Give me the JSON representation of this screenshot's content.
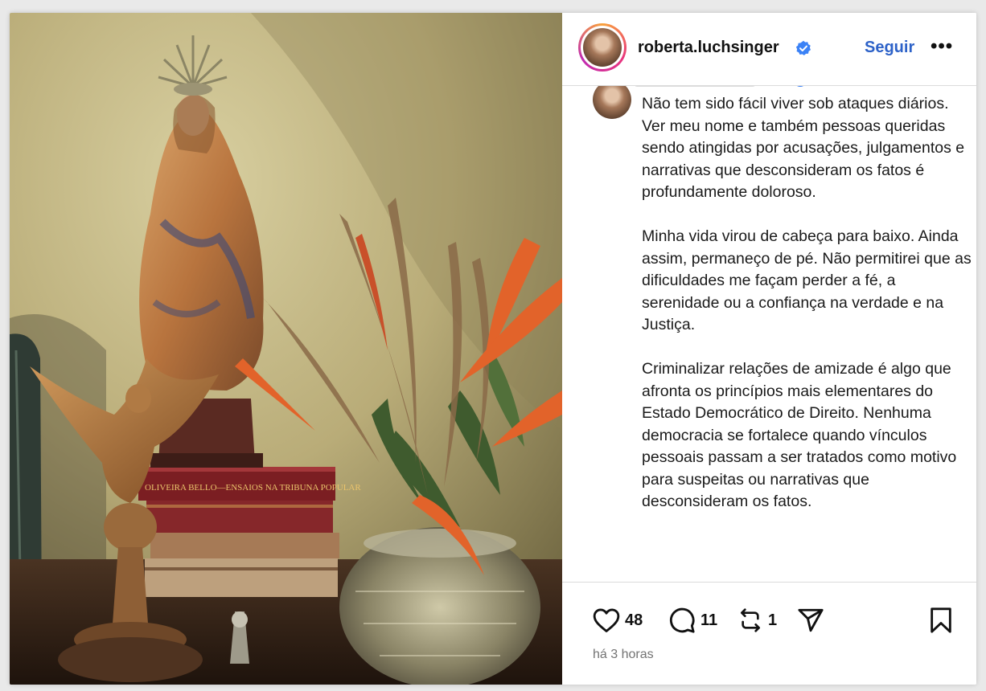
{
  "post": {
    "author": {
      "username": "roberta.luchsinger",
      "verified": true,
      "verified_icon": "verified-badge-icon",
      "follow_label": "Seguir",
      "more_icon": "more-options-icon",
      "more_label": "•••"
    },
    "caption": {
      "paragraphs": [
        "Não tem sido fácil viver sob ataques diários. Ver meu nome e também pessoas queridas sendo atingidas por acusações, julgamentos e narrativas que desconsideram os fatos é profundamente doloroso.",
        "Minha vida virou de cabeça para baixo. Ainda assim, permaneço de pé. Não permitirei que as dificuldades me façam perder a fé, a serenidade ou a confiança na verdade e na Justiça.",
        "Criminalizar relações de amizade é algo que afronta os princípios mais elementares do Estado Democrático de Direito. Nenhuma democracia se fortalece quando vínculos pessoais passam a ser tratados como motivo para suspeitas ou narrativas que desconsideram os fatos."
      ]
    },
    "actions": {
      "like_icon": "heart-icon",
      "likes": "48",
      "comment_icon": "comment-icon",
      "comments": "11",
      "repost_icon": "repost-icon",
      "reposts": "1",
      "share_icon": "send-icon",
      "save_icon": "bookmark-icon"
    },
    "timestamp": "há 3 horas",
    "photo": {
      "book_spine_text": "OLIVEIRA BELLO—ENSAIOS NA TRIBUNA POPULAR"
    },
    "colors": {
      "accent": "#2d62c8",
      "verified": "#3b82f6",
      "divider": "#dbdbdb",
      "muted": "#737373"
    }
  }
}
